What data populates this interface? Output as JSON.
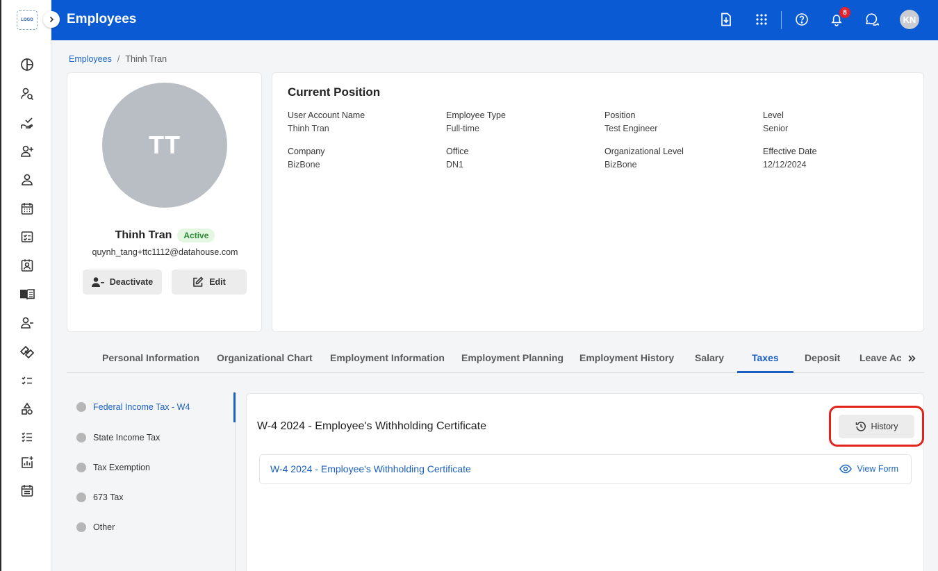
{
  "app": {
    "logo_text": "LOGO",
    "page_title": "Employees",
    "notification_count": "8",
    "user_initials": "KN"
  },
  "sidebar": {
    "icons": [
      "dashboard-icon",
      "user-search-icon",
      "hand-check-icon",
      "user-plus-icon",
      "user-icon",
      "calendar-icon",
      "checklist-icon",
      "contact-card-icon",
      "book-icon",
      "user-minus-icon",
      "handshake-icon",
      "task-list-icon",
      "shapes-icon",
      "list-check-icon",
      "report-add-icon",
      "calendar-list-icon"
    ]
  },
  "breadcrumb": {
    "root": "Employees",
    "separator": "/",
    "current": "Thinh Tran"
  },
  "profile": {
    "initials": "TT",
    "name": "Thinh Tran",
    "status": "Active",
    "email": "quynh_tang+ttc1112@datahouse.com",
    "deactivate_label": "Deactivate",
    "edit_label": "Edit"
  },
  "position": {
    "title": "Current Position",
    "fields": [
      {
        "label": "User Account Name",
        "value": "Thinh Tran"
      },
      {
        "label": "Employee Type",
        "value": "Full-time"
      },
      {
        "label": "Position",
        "value": "Test Engineer"
      },
      {
        "label": "Level",
        "value": "Senior"
      },
      {
        "label": "Company",
        "value": "BizBone"
      },
      {
        "label": "Office",
        "value": "DN1"
      },
      {
        "label": "Organizational Level",
        "value": "BizBone"
      },
      {
        "label": "Effective Date",
        "value": "12/12/2024"
      }
    ]
  },
  "tabs": [
    "Personal Information",
    "Organizational Chart",
    "Employment Information",
    "Employment Planning",
    "Employment History",
    "Salary",
    "Taxes",
    "Deposit",
    "Leave Ac"
  ],
  "active_tab": "Taxes",
  "tax_sections": [
    "Federal Income Tax - W4",
    "State Income Tax",
    "Tax Exemption",
    "673 Tax",
    "Other"
  ],
  "w4": {
    "title": "W-4 2024 - Employee's Withholding Certificate",
    "history_label": "History",
    "form_link": "W-4 2024 - Employee's Withholding Certificate",
    "view_form_label": "View Form"
  },
  "colors": {
    "brand_blue": "#0a5bd3",
    "link_blue": "#1a5fc0",
    "active_green": "#2c8a35",
    "badge_red": "#e0232e",
    "highlight_red": "#e0231b"
  }
}
